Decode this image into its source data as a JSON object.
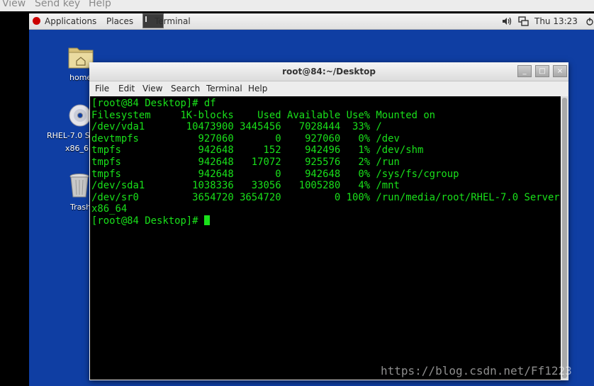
{
  "vm_menubar": {
    "items": [
      "View",
      "Send key",
      "Help"
    ]
  },
  "topbar": {
    "applications": "Applications",
    "places": "Places",
    "task_label": "Terminal",
    "clock": "Thu 13:23"
  },
  "desktop": {
    "icons": [
      {
        "label": "home",
        "icon": "folder-home-icon"
      },
      {
        "label_line1": "RHEL-7.0 S",
        "label_line2": "x86_6",
        "icon": "dvd-icon"
      },
      {
        "label": "Trash",
        "icon": "trash-icon"
      }
    ]
  },
  "terminal": {
    "title": "root@84:~/Desktop",
    "menu": [
      "File",
      "Edit",
      "View",
      "Search",
      "Terminal",
      "Help"
    ],
    "lines": [
      "[root@84 Desktop]# df",
      "Filesystem     1K-blocks    Used Available Use% Mounted on",
      "/dev/vda1       10473900 3445456   7028444  33% /",
      "devtmpfs          927060       0    927060   0% /dev",
      "tmpfs             942648     152    942496   1% /dev/shm",
      "tmpfs             942648   17072    925576   2% /run",
      "tmpfs             942648       0    942648   0% /sys/fs/cgroup",
      "/dev/sda1        1038336   33056   1005280   4% /mnt",
      "/dev/sr0         3654720 3654720         0 100% /run/media/root/RHEL-7.0 Server.",
      "x86_64"
    ],
    "prompt": "[root@84 Desktop]# "
  },
  "watermark": "https://blog.csdn.net/Ff1223"
}
